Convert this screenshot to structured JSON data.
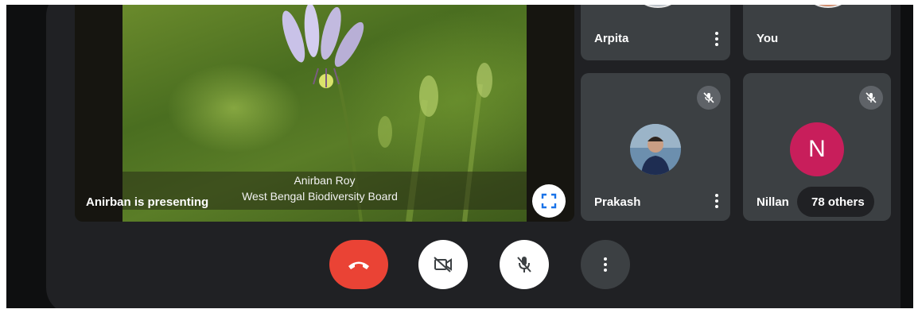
{
  "presentation": {
    "presenter_label": "Anirban is presenting",
    "slide_title_name": "Anirban Roy",
    "slide_title_org": "West Bengal Biodiversity Board",
    "fullscreen_icon": "fullscreen-icon"
  },
  "participants": [
    {
      "name": "Arpita",
      "muted": false
    },
    {
      "name": "You",
      "muted": false
    },
    {
      "name": "Prakash",
      "muted": true,
      "avatar": "photo"
    },
    {
      "name": "Nillan",
      "muted": true,
      "avatar_letter": "N",
      "avatar_color": "#c81e5b"
    }
  ],
  "others": {
    "label": "78 others"
  },
  "controls": {
    "hangup_icon": "phone-hangup-icon",
    "camera_icon": "camera-off-icon",
    "mic_icon": "mic-off-icon",
    "more_icon": "more-vertical-icon"
  },
  "colors": {
    "surface": "#202124",
    "tile": "#3c4043",
    "hangup": "#ea4335",
    "avatar_n": "#c81e5b"
  }
}
